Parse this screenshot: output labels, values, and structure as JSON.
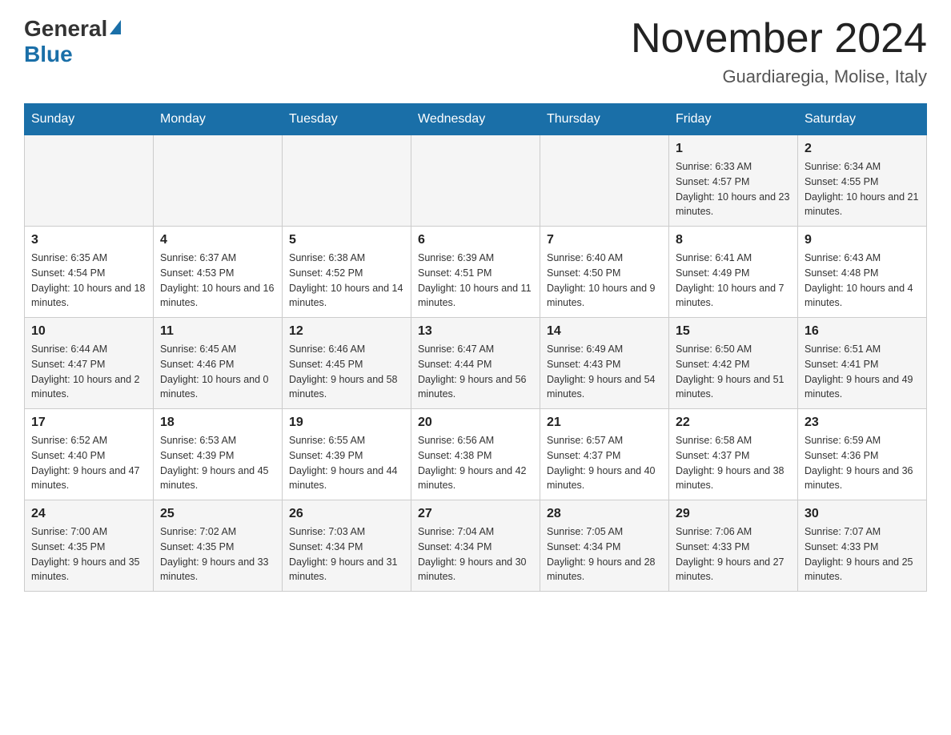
{
  "header": {
    "logo_general": "General",
    "logo_blue": "Blue",
    "month_title": "November 2024",
    "location": "Guardiaregia, Molise, Italy"
  },
  "days_of_week": [
    "Sunday",
    "Monday",
    "Tuesday",
    "Wednesday",
    "Thursday",
    "Friday",
    "Saturday"
  ],
  "weeks": [
    [
      {
        "day": "",
        "sunrise": "",
        "sunset": "",
        "daylight": ""
      },
      {
        "day": "",
        "sunrise": "",
        "sunset": "",
        "daylight": ""
      },
      {
        "day": "",
        "sunrise": "",
        "sunset": "",
        "daylight": ""
      },
      {
        "day": "",
        "sunrise": "",
        "sunset": "",
        "daylight": ""
      },
      {
        "day": "",
        "sunrise": "",
        "sunset": "",
        "daylight": ""
      },
      {
        "day": "1",
        "sunrise": "Sunrise: 6:33 AM",
        "sunset": "Sunset: 4:57 PM",
        "daylight": "Daylight: 10 hours and 23 minutes."
      },
      {
        "day": "2",
        "sunrise": "Sunrise: 6:34 AM",
        "sunset": "Sunset: 4:55 PM",
        "daylight": "Daylight: 10 hours and 21 minutes."
      }
    ],
    [
      {
        "day": "3",
        "sunrise": "Sunrise: 6:35 AM",
        "sunset": "Sunset: 4:54 PM",
        "daylight": "Daylight: 10 hours and 18 minutes."
      },
      {
        "day": "4",
        "sunrise": "Sunrise: 6:37 AM",
        "sunset": "Sunset: 4:53 PM",
        "daylight": "Daylight: 10 hours and 16 minutes."
      },
      {
        "day": "5",
        "sunrise": "Sunrise: 6:38 AM",
        "sunset": "Sunset: 4:52 PM",
        "daylight": "Daylight: 10 hours and 14 minutes."
      },
      {
        "day": "6",
        "sunrise": "Sunrise: 6:39 AM",
        "sunset": "Sunset: 4:51 PM",
        "daylight": "Daylight: 10 hours and 11 minutes."
      },
      {
        "day": "7",
        "sunrise": "Sunrise: 6:40 AM",
        "sunset": "Sunset: 4:50 PM",
        "daylight": "Daylight: 10 hours and 9 minutes."
      },
      {
        "day": "8",
        "sunrise": "Sunrise: 6:41 AM",
        "sunset": "Sunset: 4:49 PM",
        "daylight": "Daylight: 10 hours and 7 minutes."
      },
      {
        "day": "9",
        "sunrise": "Sunrise: 6:43 AM",
        "sunset": "Sunset: 4:48 PM",
        "daylight": "Daylight: 10 hours and 4 minutes."
      }
    ],
    [
      {
        "day": "10",
        "sunrise": "Sunrise: 6:44 AM",
        "sunset": "Sunset: 4:47 PM",
        "daylight": "Daylight: 10 hours and 2 minutes."
      },
      {
        "day": "11",
        "sunrise": "Sunrise: 6:45 AM",
        "sunset": "Sunset: 4:46 PM",
        "daylight": "Daylight: 10 hours and 0 minutes."
      },
      {
        "day": "12",
        "sunrise": "Sunrise: 6:46 AM",
        "sunset": "Sunset: 4:45 PM",
        "daylight": "Daylight: 9 hours and 58 minutes."
      },
      {
        "day": "13",
        "sunrise": "Sunrise: 6:47 AM",
        "sunset": "Sunset: 4:44 PM",
        "daylight": "Daylight: 9 hours and 56 minutes."
      },
      {
        "day": "14",
        "sunrise": "Sunrise: 6:49 AM",
        "sunset": "Sunset: 4:43 PM",
        "daylight": "Daylight: 9 hours and 54 minutes."
      },
      {
        "day": "15",
        "sunrise": "Sunrise: 6:50 AM",
        "sunset": "Sunset: 4:42 PM",
        "daylight": "Daylight: 9 hours and 51 minutes."
      },
      {
        "day": "16",
        "sunrise": "Sunrise: 6:51 AM",
        "sunset": "Sunset: 4:41 PM",
        "daylight": "Daylight: 9 hours and 49 minutes."
      }
    ],
    [
      {
        "day": "17",
        "sunrise": "Sunrise: 6:52 AM",
        "sunset": "Sunset: 4:40 PM",
        "daylight": "Daylight: 9 hours and 47 minutes."
      },
      {
        "day": "18",
        "sunrise": "Sunrise: 6:53 AM",
        "sunset": "Sunset: 4:39 PM",
        "daylight": "Daylight: 9 hours and 45 minutes."
      },
      {
        "day": "19",
        "sunrise": "Sunrise: 6:55 AM",
        "sunset": "Sunset: 4:39 PM",
        "daylight": "Daylight: 9 hours and 44 minutes."
      },
      {
        "day": "20",
        "sunrise": "Sunrise: 6:56 AM",
        "sunset": "Sunset: 4:38 PM",
        "daylight": "Daylight: 9 hours and 42 minutes."
      },
      {
        "day": "21",
        "sunrise": "Sunrise: 6:57 AM",
        "sunset": "Sunset: 4:37 PM",
        "daylight": "Daylight: 9 hours and 40 minutes."
      },
      {
        "day": "22",
        "sunrise": "Sunrise: 6:58 AM",
        "sunset": "Sunset: 4:37 PM",
        "daylight": "Daylight: 9 hours and 38 minutes."
      },
      {
        "day": "23",
        "sunrise": "Sunrise: 6:59 AM",
        "sunset": "Sunset: 4:36 PM",
        "daylight": "Daylight: 9 hours and 36 minutes."
      }
    ],
    [
      {
        "day": "24",
        "sunrise": "Sunrise: 7:00 AM",
        "sunset": "Sunset: 4:35 PM",
        "daylight": "Daylight: 9 hours and 35 minutes."
      },
      {
        "day": "25",
        "sunrise": "Sunrise: 7:02 AM",
        "sunset": "Sunset: 4:35 PM",
        "daylight": "Daylight: 9 hours and 33 minutes."
      },
      {
        "day": "26",
        "sunrise": "Sunrise: 7:03 AM",
        "sunset": "Sunset: 4:34 PM",
        "daylight": "Daylight: 9 hours and 31 minutes."
      },
      {
        "day": "27",
        "sunrise": "Sunrise: 7:04 AM",
        "sunset": "Sunset: 4:34 PM",
        "daylight": "Daylight: 9 hours and 30 minutes."
      },
      {
        "day": "28",
        "sunrise": "Sunrise: 7:05 AM",
        "sunset": "Sunset: 4:34 PM",
        "daylight": "Daylight: 9 hours and 28 minutes."
      },
      {
        "day": "29",
        "sunrise": "Sunrise: 7:06 AM",
        "sunset": "Sunset: 4:33 PM",
        "daylight": "Daylight: 9 hours and 27 minutes."
      },
      {
        "day": "30",
        "sunrise": "Sunrise: 7:07 AM",
        "sunset": "Sunset: 4:33 PM",
        "daylight": "Daylight: 9 hours and 25 minutes."
      }
    ]
  ]
}
